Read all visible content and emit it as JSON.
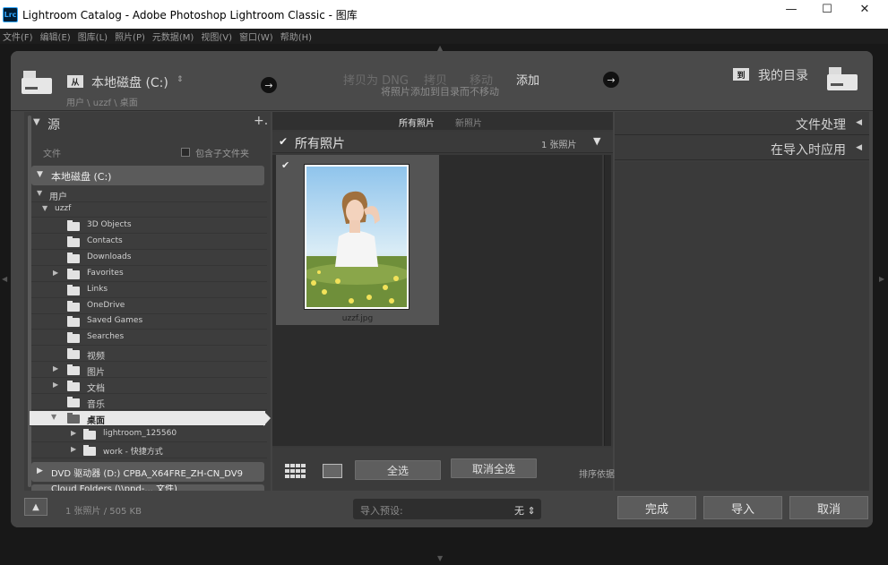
{
  "window": {
    "icon_text": "Lrc",
    "title": "Lightroom Catalog - Adobe Photoshop Lightroom Classic - 图库",
    "minimize": "—",
    "maximize": "☐",
    "close": "✕"
  },
  "menu": [
    "文件(F)",
    "编辑(E)",
    "图库(L)",
    "照片(P)",
    "元数据(M)",
    "视图(V)",
    "窗口(W)",
    "帮助(H)"
  ],
  "header": {
    "source_badge": "从",
    "source_title": "本地磁盘 (C:)",
    "source_arrows": "⇕",
    "source_path": "用户 \\ uzzf \\ 桌面",
    "modes": [
      "拷贝为 DNG",
      "拷贝",
      "移动",
      "添加"
    ],
    "active_mode": "添加",
    "mode_subtitle": "将照片添加到目录而不移动",
    "dest_badge": "到",
    "dest_title": "我的目录",
    "arrow_glyph": "→"
  },
  "source_panel": {
    "title": "源",
    "plus": "+.",
    "files_label": "文件",
    "include_subfolders": "包含子文件夹",
    "drive_c": "本地磁盘 (C:)",
    "users": "用户",
    "uzzf": "uzzf",
    "folders": [
      {
        "name": "3D Objects",
        "expandable": false
      },
      {
        "name": "Contacts",
        "expandable": false
      },
      {
        "name": "Downloads",
        "expandable": false
      },
      {
        "name": "Favorites",
        "expandable": true
      },
      {
        "name": "Links",
        "expandable": false
      },
      {
        "name": "OneDrive",
        "expandable": false
      },
      {
        "name": "Saved Games",
        "expandable": false
      },
      {
        "name": "Searches",
        "expandable": false
      },
      {
        "name": "视频",
        "expandable": false
      },
      {
        "name": "图片",
        "expandable": true
      },
      {
        "name": "文档",
        "expandable": true
      },
      {
        "name": "音乐",
        "expandable": false
      }
    ],
    "selected_folder": "桌面",
    "desktop_children": [
      "lightroom_125560",
      "work - 快捷方式"
    ],
    "drive_d": "DVD 驱动器 (D:) CPBA_X64FRE_ZH-CN_DV9",
    "cloud": "Cloud Folders (\\\\ppd-... 文件)"
  },
  "center_panel": {
    "tabs": [
      "所有照片",
      "新照片"
    ],
    "active_tab": "所有照片",
    "all_photos_label": "所有照片",
    "photo_count": "1 张照片",
    "thumb_filename": "uzzf.jpg",
    "select_all": "全选",
    "deselect_all": "取消全选",
    "sort_label": "排序依据"
  },
  "right_panel": {
    "file_handling": "文件处理",
    "apply_during_import": "在导入时应用"
  },
  "footer": {
    "info": "1 张照片 / 505 KB",
    "preset_label": "导入预设:",
    "preset_value": "无 ⇕",
    "done": "完成",
    "import": "导入",
    "cancel": "取消"
  },
  "colors": {
    "lr_blue": "#31a8ff",
    "panel_bg": "#3d3d3d",
    "selected_row": "#e8e8e8"
  }
}
